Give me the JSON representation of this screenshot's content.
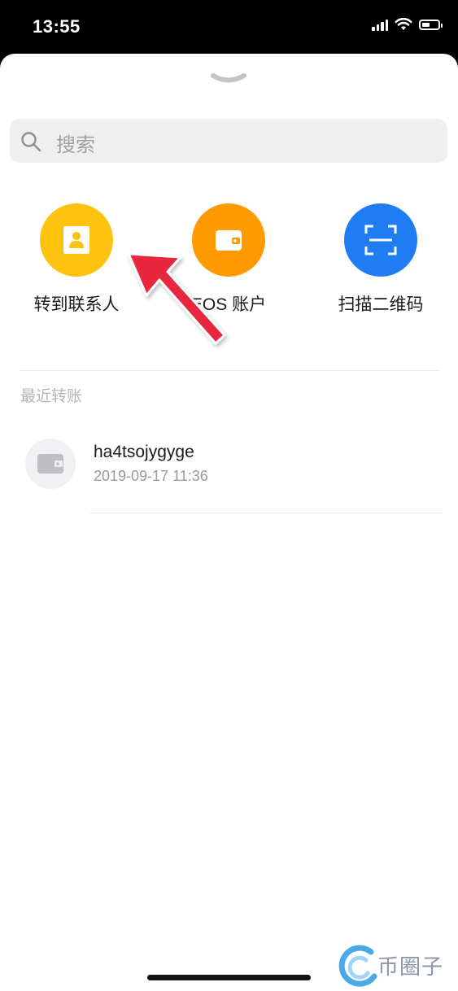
{
  "status_bar": {
    "time": "13:55",
    "icons": [
      "signal-icon",
      "wifi-icon",
      "battery-icon"
    ]
  },
  "sheet": {
    "handle_icon": "chevron-down-icon",
    "search": {
      "placeholder": "搜索",
      "icon": "search-icon"
    },
    "actions": [
      {
        "label": "转到联系人",
        "icon": "contact-card-icon",
        "color": "#ffc20e"
      },
      {
        "label": "EOS 账户",
        "icon": "wallet-icon",
        "color": "#ff9a00"
      },
      {
        "label": "扫描二维码",
        "icon": "scan-qr-icon",
        "color": "#1f7cf2"
      }
    ],
    "recent": {
      "title": "最近转账",
      "items": [
        {
          "name": "ha4tsojygyge",
          "time": "2019-09-17 11:36",
          "icon": "wallet-icon"
        }
      ]
    }
  },
  "overlay": {
    "arrow_color": "#e8263c",
    "watermark": {
      "text": "币圈子",
      "icon": "coin-logo-icon"
    }
  }
}
